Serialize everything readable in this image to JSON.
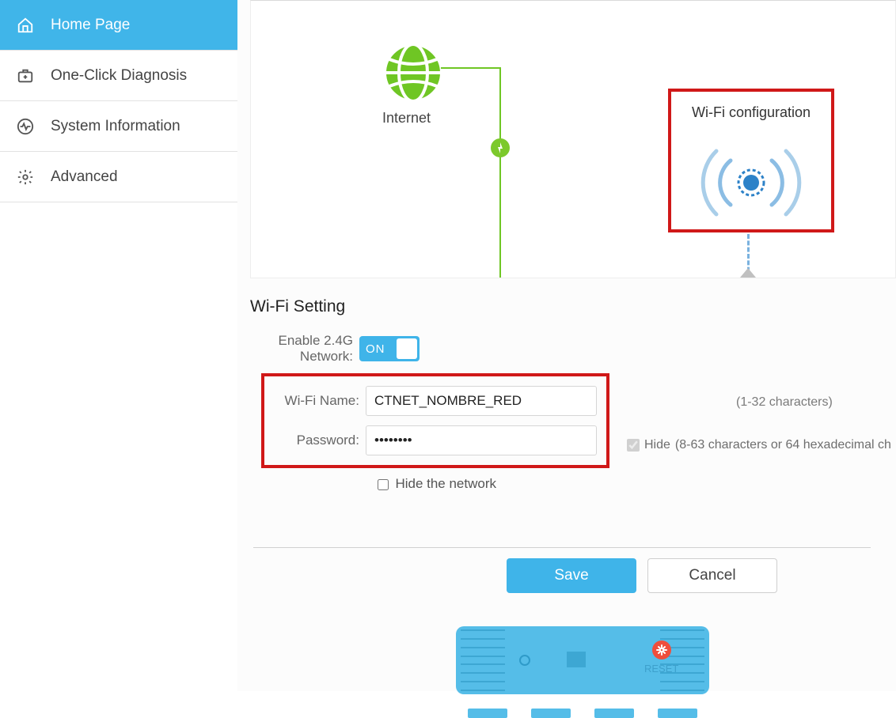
{
  "sidebar": {
    "items": [
      {
        "label": "Home Page"
      },
      {
        "label": "One-Click Diagnosis"
      },
      {
        "label": "System Information"
      },
      {
        "label": "Advanced"
      }
    ]
  },
  "diagram": {
    "internet_label": "Internet",
    "wifi_config_label": "Wi-Fi configuration"
  },
  "wifi": {
    "section_title": "Wi-Fi Setting",
    "enable_label": "Enable 2.4G Network:",
    "toggle_text": "ON",
    "name_label": "Wi-Fi Name:",
    "name_value": "CTNET_NOMBRE_RED",
    "name_hint": "(1-32 characters)",
    "password_label": "Password:",
    "password_value": "••••••••",
    "hide_label": "Hide",
    "password_hint": "(8-63 characters or 64 hexadecimal ch",
    "hide_network_label": "Hide the network",
    "save_label": "Save",
    "cancel_label": "Cancel"
  },
  "router": {
    "reset_label": "RESET"
  }
}
